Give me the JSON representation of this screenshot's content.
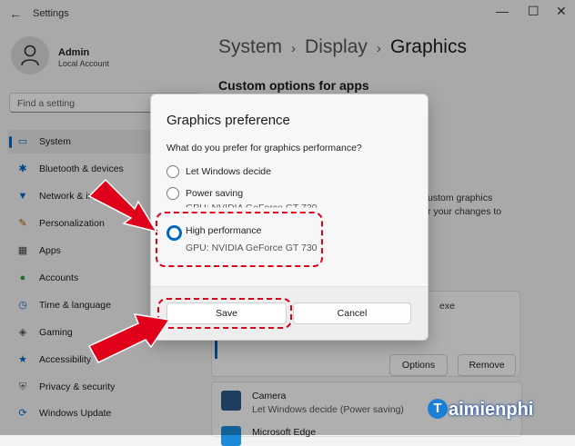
{
  "window": {
    "title": "Settings",
    "back_icon": "back-arrow-icon",
    "min": "—",
    "max": "☐",
    "close": "✕"
  },
  "user": {
    "name": "Admin",
    "type": "Local Account"
  },
  "search": {
    "placeholder": "Find a setting"
  },
  "sidebar": {
    "items": [
      {
        "label": "System",
        "icon": "monitor-icon",
        "selected": true
      },
      {
        "label": "Bluetooth & devices",
        "icon": "bluetooth-icon"
      },
      {
        "label": "Network & internet",
        "icon": "wifi-icon"
      },
      {
        "label": "Personalization",
        "icon": "brush-icon"
      },
      {
        "label": "Apps",
        "icon": "apps-icon"
      },
      {
        "label": "Accounts",
        "icon": "person-icon"
      },
      {
        "label": "Time & language",
        "icon": "globe-clock-icon"
      },
      {
        "label": "Gaming",
        "icon": "gamepad-icon"
      },
      {
        "label": "Accessibility",
        "icon": "accessibility-icon"
      },
      {
        "label": "Privacy & security",
        "icon": "shield-icon"
      },
      {
        "label": "Windows Update",
        "icon": "update-icon"
      }
    ]
  },
  "main": {
    "breadcrumb": [
      "System",
      "Display",
      "Graphics"
    ],
    "section_title": "Custom options for apps",
    "bg_line1": "ustom graphics",
    "bg_line2": "r your changes to",
    "bg_exe": "exe",
    "options_label": "Options",
    "remove_label": "Remove",
    "camera_name": "Camera",
    "camera_sub": "Let Windows decide (Power saving)",
    "next_app": "Microsoft Edge"
  },
  "dialog": {
    "title": "Graphics preference",
    "question": "What do you prefer for graphics performance?",
    "options": [
      {
        "label": "Let Windows decide",
        "sub": ""
      },
      {
        "label": "Power saving",
        "sub": "GPU: NVIDIA GeForce GT 730"
      },
      {
        "label": "High performance",
        "sub": "GPU: NVIDIA GeForce GT 730"
      }
    ],
    "selected_index": 2,
    "save_label": "Save",
    "cancel_label": "Cancel"
  },
  "watermark": {
    "text": "aimienphi",
    "logo_letter": "T"
  },
  "colors": {
    "accent": "#0067c0",
    "annotation": "#e0001a"
  }
}
